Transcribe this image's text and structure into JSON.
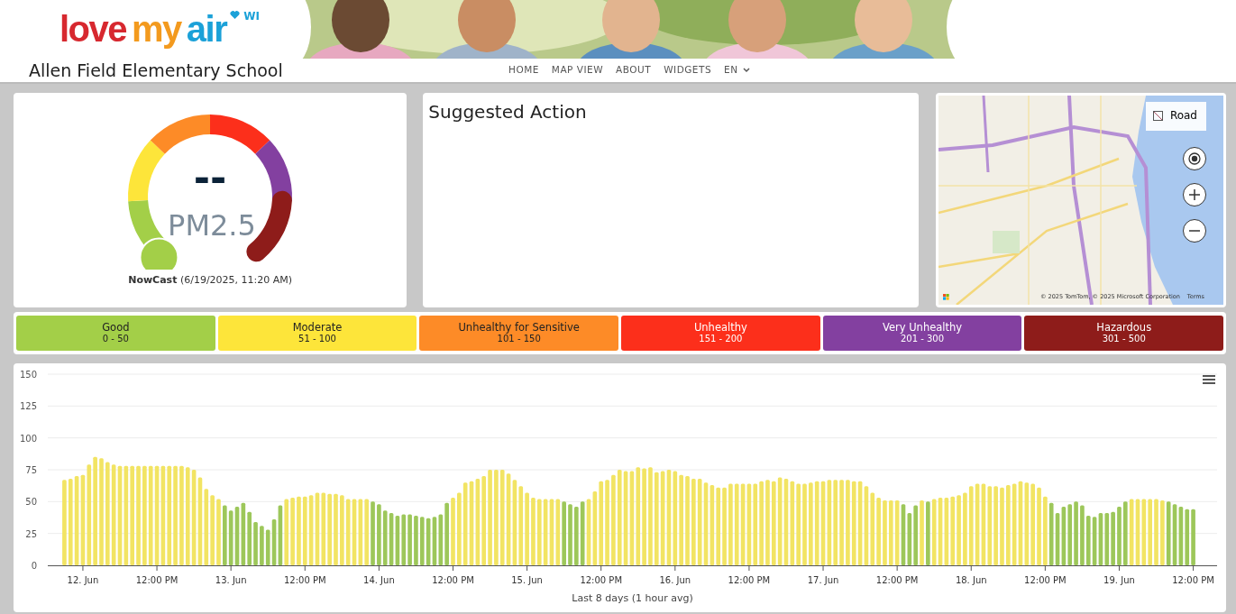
{
  "logo": {
    "parts": [
      {
        "text": "love",
        "color": "#d7282f"
      },
      {
        "text": "my",
        "color": "#f39a1e"
      },
      {
        "text": "air",
        "color": "#1ba1d8"
      }
    ],
    "region": "WI"
  },
  "header": {
    "site_title": "Allen Field Elementary School"
  },
  "nav": [
    {
      "label": "HOME"
    },
    {
      "label": "MAP VIEW"
    },
    {
      "label": "ABOUT"
    },
    {
      "label": "WIDGETS"
    },
    {
      "label": "EN",
      "dropdown": true
    }
  ],
  "gauge": {
    "value": "--",
    "pollutant": "PM2.5",
    "caption": "NowCast",
    "time": "(6/19/2025, 11:20 AM)"
  },
  "suggested_action": {
    "title": "Suggested Action"
  },
  "map": {
    "kind": "picture",
    "style_button": "Road",
    "attribution": "© 2025 TomTom, © 2025 Microsoft Corporation",
    "terms": "Terms"
  },
  "legend": [
    {
      "name": "Good",
      "range": "0 - 50",
      "color": "#a3cf48"
    },
    {
      "name": "Moderate",
      "range": "51 - 100",
      "color": "#fde53a"
    },
    {
      "name": "Unhealthy for Sensitive",
      "range": "101 - 150",
      "color": "#fd8b27"
    },
    {
      "name": "Unhealthy",
      "range": "151 - 200",
      "color": "#fc2f1b"
    },
    {
      "name": "Very Unhealthy",
      "range": "201 - 300",
      "color": "#8340a0"
    },
    {
      "name": "Hazardous",
      "range": "301 - 500",
      "color": "#8e1c1a"
    }
  ],
  "chart": {
    "chart_data": {
      "type": "bar",
      "grid": true,
      "xlabel": "Last 8 days (1 hour avg)",
      "ylim": [
        0,
        150
      ],
      "yticks": [
        0,
        25,
        50,
        75,
        100,
        125,
        150
      ],
      "categories": [
        null,
        null,
        null,
        "12. Jun",
        null,
        null,
        null,
        null,
        null,
        null,
        null,
        null,
        null,
        null,
        null,
        "12:00 PM",
        null,
        null,
        null,
        null,
        null,
        null,
        null,
        null,
        null,
        null,
        null,
        "13. Jun",
        null,
        null,
        null,
        null,
        null,
        null,
        null,
        null,
        null,
        null,
        null,
        "12:00 PM",
        null,
        null,
        null,
        null,
        null,
        null,
        null,
        null,
        null,
        null,
        null,
        "14. Jun",
        null,
        null,
        null,
        null,
        null,
        null,
        null,
        null,
        null,
        null,
        null,
        "12:00 PM",
        null,
        null,
        null,
        null,
        null,
        null,
        null,
        null,
        null,
        null,
        null,
        "15. Jun",
        null,
        null,
        null,
        null,
        null,
        null,
        null,
        null,
        null,
        null,
        null,
        "12:00 PM",
        null,
        null,
        null,
        null,
        null,
        null,
        null,
        null,
        null,
        null,
        null,
        "16. Jun",
        null,
        null,
        null,
        null,
        null,
        null,
        null,
        null,
        null,
        null,
        null,
        "12:00 PM",
        null,
        null,
        null,
        null,
        null,
        null,
        null,
        null,
        null,
        null,
        null,
        "17. Jun",
        null,
        null,
        null,
        null,
        null,
        null,
        null,
        null,
        null,
        null,
        null,
        "12:00 PM",
        null,
        null,
        null,
        null,
        null,
        null,
        null,
        null,
        null,
        null,
        null,
        "18. Jun",
        null,
        null,
        null,
        null,
        null,
        null,
        null,
        null,
        null,
        null,
        null,
        "12:00 PM",
        null,
        null,
        null,
        null,
        null,
        null,
        null,
        null,
        null,
        null,
        null,
        "19. Jun",
        null,
        null,
        null,
        null,
        null,
        null,
        null,
        null,
        null,
        null,
        null,
        "12:00 PM"
      ],
      "series": [
        {
          "color": "#f2e463",
          "values": [
            67,
            68,
            70,
            71,
            79,
            85,
            84,
            81,
            79,
            78,
            78,
            78,
            78,
            78,
            78,
            78,
            78,
            78,
            78,
            78,
            77,
            75,
            69,
            60,
            55,
            52,
            null,
            null,
            null,
            null,
            null,
            null,
            null,
            null,
            null,
            null,
            52,
            53,
            54,
            54,
            55,
            57,
            57,
            56,
            56,
            55,
            52,
            52,
            52,
            52,
            null,
            null,
            null,
            null,
            null,
            null,
            null,
            null,
            null,
            null,
            null,
            null,
            null,
            53,
            57,
            65,
            66,
            68,
            70,
            75,
            75,
            75,
            72,
            67,
            62,
            57,
            53,
            52,
            52,
            52,
            52,
            null,
            null,
            null,
            null,
            52,
            58,
            66,
            67,
            71,
            75,
            74,
            74,
            77,
            76,
            77,
            73,
            74,
            75,
            74,
            71,
            70,
            68,
            68,
            65,
            63,
            61,
            61,
            64,
            64,
            64,
            64,
            64,
            66,
            67,
            66,
            69,
            68,
            66,
            64,
            64,
            65,
            66,
            66,
            67,
            67,
            67,
            67,
            66,
            66,
            62,
            57,
            53,
            51,
            51,
            51,
            null,
            null,
            null,
            51,
            null,
            52,
            53,
            53,
            54,
            55,
            57,
            62,
            64,
            64,
            62,
            62,
            61,
            63,
            64,
            66,
            65,
            64,
            61,
            54,
            null,
            null,
            null,
            null,
            null,
            null,
            null,
            null,
            null,
            null,
            null,
            null,
            null,
            52,
            52,
            52,
            52,
            52,
            51,
            null,
            null,
            null,
            null,
            null
          ]
        },
        {
          "color": "#9dc75a",
          "values": [
            null,
            null,
            null,
            null,
            null,
            null,
            null,
            null,
            null,
            null,
            null,
            null,
            null,
            null,
            null,
            null,
            null,
            null,
            null,
            null,
            null,
            null,
            null,
            null,
            null,
            null,
            47,
            43,
            46,
            49,
            42,
            34,
            31,
            28,
            36,
            47,
            null,
            null,
            null,
            null,
            null,
            null,
            null,
            null,
            null,
            null,
            null,
            null,
            null,
            null,
            50,
            48,
            43,
            41,
            39,
            40,
            40,
            39,
            38,
            37,
            38,
            40,
            49,
            null,
            null,
            null,
            null,
            null,
            null,
            null,
            null,
            null,
            null,
            null,
            null,
            null,
            null,
            null,
            null,
            null,
            null,
            50,
            48,
            46,
            50,
            null,
            null,
            null,
            null,
            null,
            null,
            null,
            null,
            null,
            null,
            null,
            null,
            null,
            null,
            null,
            null,
            null,
            null,
            null,
            null,
            null,
            null,
            null,
            null,
            null,
            null,
            null,
            null,
            null,
            null,
            null,
            null,
            null,
            null,
            null,
            null,
            null,
            null,
            null,
            null,
            null,
            null,
            null,
            null,
            null,
            null,
            null,
            null,
            null,
            null,
            null,
            48,
            41,
            47,
            null,
            50,
            null,
            null,
            null,
            null,
            null,
            null,
            null,
            null,
            null,
            null,
            null,
            null,
            null,
            null,
            null,
            null,
            null,
            null,
            null,
            49,
            41,
            46,
            48,
            50,
            47,
            39,
            38,
            41,
            41,
            42,
            46,
            50,
            null,
            null,
            null,
            null,
            null,
            null,
            50,
            48,
            46,
            44,
            44
          ]
        }
      ]
    }
  }
}
